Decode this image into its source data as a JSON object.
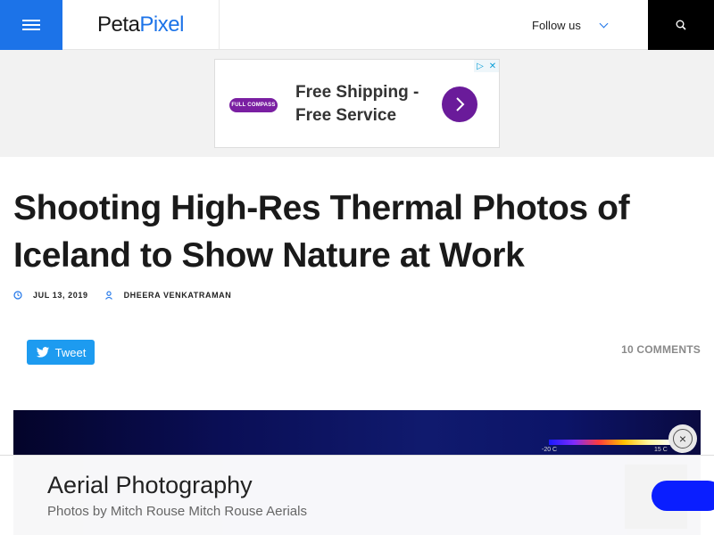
{
  "header": {
    "logo_part1": "Peta",
    "logo_part2": "Pixel",
    "follow_label": "Follow us"
  },
  "top_ad": {
    "brand_logo_text": "FULL COMPASS",
    "headline": "Free Shipping - Free Service"
  },
  "article": {
    "title": "Shooting High-Res Thermal Photos of Iceland to Show Nature at Work",
    "date": "JUL 13, 2019",
    "author": "DHEERA VENKATRAMAN",
    "tweet_label": "Tweet",
    "comments_label": "10 COMMENTS"
  },
  "thermal_image": {
    "scale_min": "-20 C",
    "scale_max": "15 C"
  },
  "bottom_ad": {
    "title": "Aerial Photography",
    "subtitle": "Photos by Mitch Rouse Mitch Rouse Aerials"
  },
  "colors": {
    "accent": "#1c73e8",
    "twitter": "#1d9bf0",
    "ad_purple": "#6a1b9a"
  }
}
